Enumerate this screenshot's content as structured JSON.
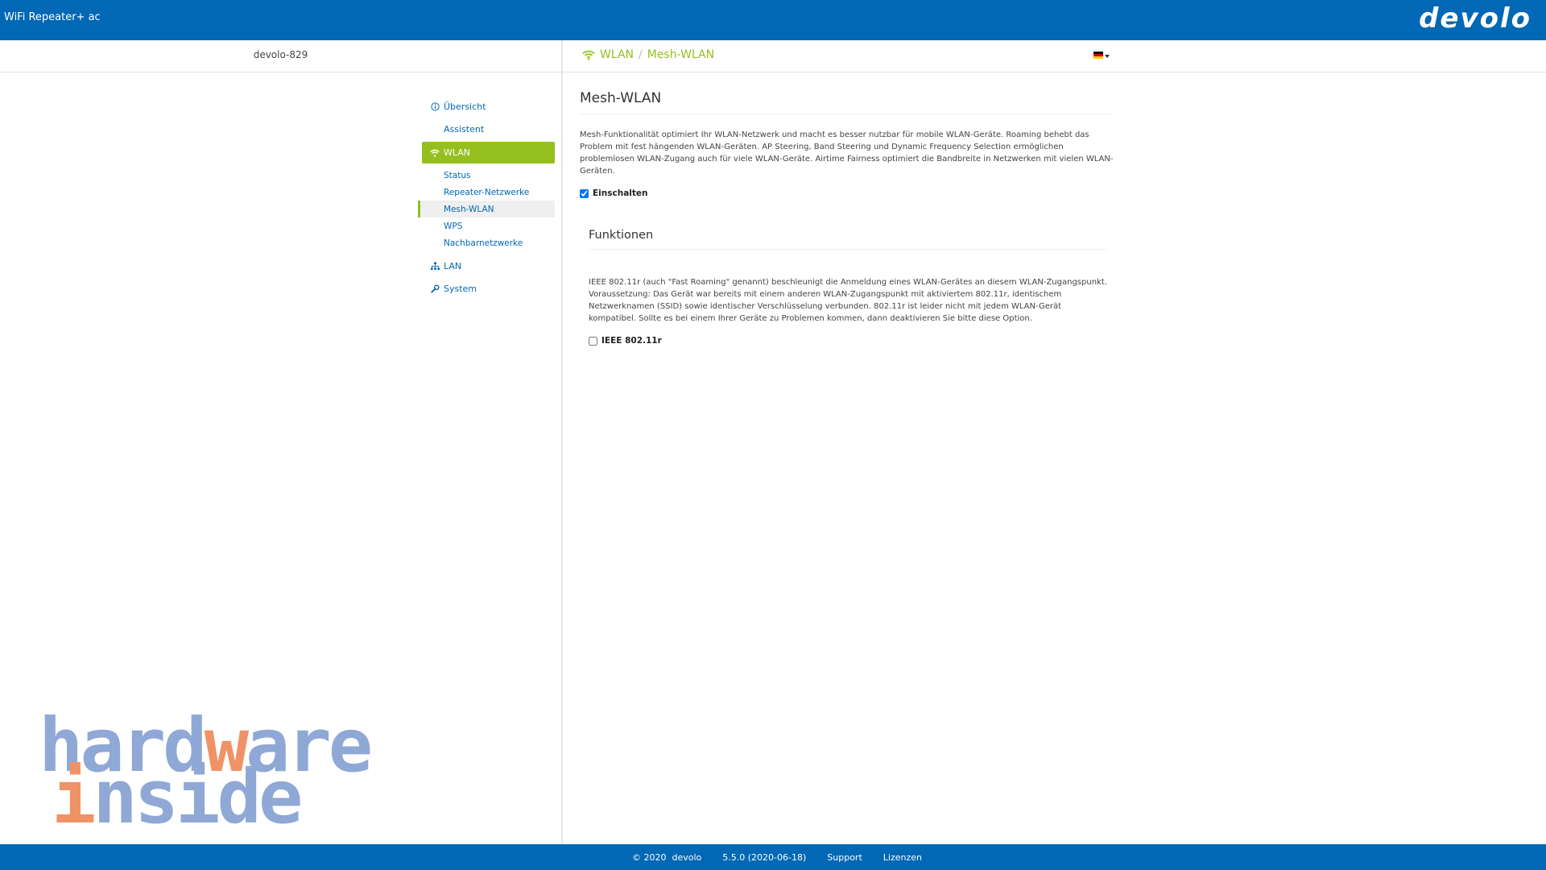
{
  "header": {
    "app_title": "WiFi Repeater+ ac",
    "brand": "devolo"
  },
  "device": {
    "name": "devolo-829"
  },
  "breadcrumb": {
    "section": "WLAN",
    "separator": "/",
    "page": "Mesh-WLAN"
  },
  "language": {
    "flag": "de",
    "colors": [
      "#000000",
      "#dd0000",
      "#ffce00"
    ]
  },
  "sidebar": {
    "items": [
      {
        "label": "Übersicht",
        "icon": "info-circle-icon"
      },
      {
        "label": "Assistent"
      },
      {
        "label": "WLAN",
        "icon": "wifi-icon",
        "active": true
      },
      {
        "label": "LAN",
        "icon": "network-icon"
      },
      {
        "label": "System",
        "icon": "wrench-icon"
      }
    ],
    "wlan_subitems": [
      "Status",
      "Repeater-Netzwerke",
      "Mesh-WLAN",
      "WPS",
      "Nachbarnetzwerke"
    ],
    "current_subitem": "Mesh-WLAN"
  },
  "content": {
    "title": "Mesh-WLAN",
    "description": "Mesh-Funktionalität optimiert Ihr WLAN-Netzwerk und macht es besser nutzbar für mobile WLAN-Geräte. Roaming behebt das Problem mit fest hängenden WLAN-Geräten. AP Steering, Band Steering und Dynamic Frequency Selection ermöglichen problemlosen WLAN-Zugang auch für viele WLAN-Geräte. Airtime Fairness optimiert die Bandbreite in Netzwerken mit vielen WLAN-Geräten.",
    "enable_label": "Einschalten",
    "enable_checked": true,
    "functions": {
      "title": "Funktionen",
      "description": "IEEE 802.11r (auch \"Fast Roaming\" genannt) beschleunigt die Anmeldung eines WLAN-Gerätes an diesem WLAN-Zugangspunkt. Voraussetzung: Das Gerät war bereits mit einem anderen WLAN-Zugangspunkt mit aktiviertem 802.11r, identischem Netzwerknamen (SSID) sowie identischer Verschlüsselung verbunden. 802.11r ist leider nicht mit jedem WLAN-Gerät kompatibel. Sollte es bei einem Ihrer Geräte zu Problemen kommen, dann deaktivieren Sie bitte diese Option.",
      "ieee_label": "IEEE 802.11r",
      "ieee_checked": false
    }
  },
  "watermark": {
    "line1_a": "hard",
    "line1_b": "w",
    "line1_c": "are",
    "line2_a": "i",
    "line2_b": "nside"
  },
  "footer": {
    "copyright": "© 2020",
    "company": "devolo",
    "version": "5.5.0 (2020-06-18)",
    "support": "Support",
    "licenses": "Lizenzen"
  },
  "colors": {
    "primary_blue": "#0068b4",
    "accent_green": "#95bf1f"
  }
}
